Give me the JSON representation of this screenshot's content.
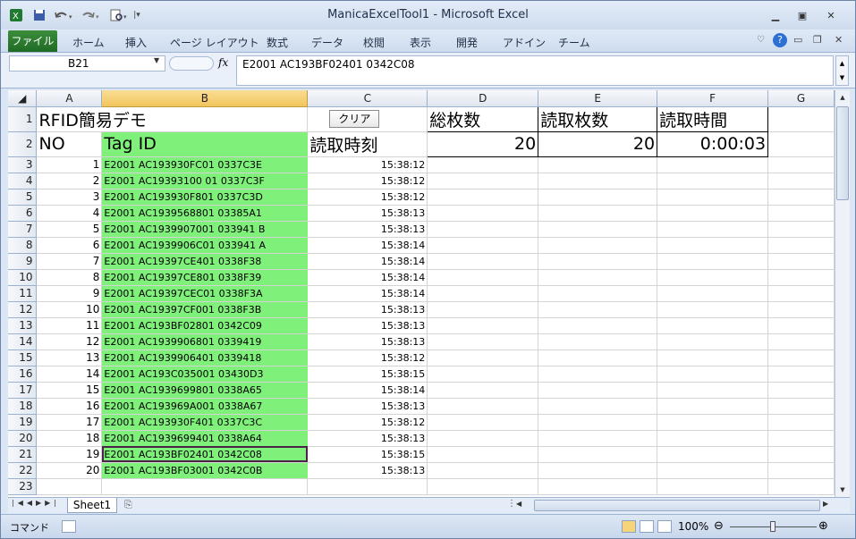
{
  "title": {
    "text": "ManicaExcelTool1 - Microsoft Excel"
  },
  "ribbon": {
    "file": "ファイル",
    "tabs": [
      "ホーム",
      "挿入",
      "ページ レイアウト",
      "数式",
      "データ",
      "校閲",
      "表示",
      "開発",
      "アドイン",
      "チーム"
    ]
  },
  "formula": {
    "namebox": "B21",
    "fx": "fx",
    "content": "E2001 AC193BF02401 0342C08"
  },
  "columns": [
    "A",
    "B",
    "C",
    "D",
    "E",
    "F",
    "G"
  ],
  "header_rows": {
    "r1": {
      "title": "RFID簡易デモ",
      "clear": "クリア",
      "total_label": "総枚数",
      "read_label": "読取枚数",
      "time_label": "読取時間"
    },
    "r2": {
      "no": "NO",
      "tag": "Tag ID",
      "readtime": "読取時刻",
      "total": "20",
      "read": "20",
      "elapsed": "0:00:03"
    }
  },
  "rows": [
    {
      "row": "3",
      "no": "1",
      "tag": "E2001 AC193930FC01 0337C3E",
      "time": "15:38:12"
    },
    {
      "row": "4",
      "no": "2",
      "tag": "E2001 AC19393100 01 0337C3F",
      "time": "15:38:12"
    },
    {
      "row": "5",
      "no": "3",
      "tag": "E2001 AC193930F801 0337C3D",
      "time": "15:38:12"
    },
    {
      "row": "6",
      "no": "4",
      "tag": "E2001 AC1939568801 03385A1",
      "time": "15:38:13"
    },
    {
      "row": "7",
      "no": "5",
      "tag": "E2001 AC1939907001 033941 B",
      "time": "15:38:13"
    },
    {
      "row": "8",
      "no": "6",
      "tag": "E2001 AC1939906C01 033941 A",
      "time": "15:38:14"
    },
    {
      "row": "9",
      "no": "7",
      "tag": "E2001 AC19397CE401 0338F38",
      "time": "15:38:14"
    },
    {
      "row": "10",
      "no": "8",
      "tag": "E2001 AC19397CE801 0338F39",
      "time": "15:38:14"
    },
    {
      "row": "11",
      "no": "9",
      "tag": "E2001 AC19397CEC01 0338F3A",
      "time": "15:38:14"
    },
    {
      "row": "12",
      "no": "10",
      "tag": "E2001 AC19397CF001 0338F3B",
      "time": "15:38:13"
    },
    {
      "row": "13",
      "no": "11",
      "tag": "E2001 AC193BF02801 0342C09",
      "time": "15:38:13"
    },
    {
      "row": "14",
      "no": "12",
      "tag": "E2001 AC1939906801 0339419",
      "time": "15:38:13"
    },
    {
      "row": "15",
      "no": "13",
      "tag": "E2001 AC1939906401 0339418",
      "time": "15:38:12"
    },
    {
      "row": "16",
      "no": "14",
      "tag": "E2001 AC193C035001 03430D3",
      "time": "15:38:15"
    },
    {
      "row": "17",
      "no": "15",
      "tag": "E2001 AC1939699801 0338A65",
      "time": "15:38:14"
    },
    {
      "row": "18",
      "no": "16",
      "tag": "E2001 AC193969A001 0338A67",
      "time": "15:38:13"
    },
    {
      "row": "19",
      "no": "17",
      "tag": "E2001 AC193930F401 0337C3C",
      "time": "15:38:12"
    },
    {
      "row": "20",
      "no": "18",
      "tag": "E2001 AC1939699401 0338A64",
      "time": "15:38:13"
    },
    {
      "row": "21",
      "no": "19",
      "tag": "E2001 AC193BF02401 0342C08",
      "time": "15:38:15"
    },
    {
      "row": "22",
      "no": "20",
      "tag": "E2001 AC193BF03001 0342C0B",
      "time": "15:38:13"
    }
  ],
  "empty_row": "23",
  "row_headers": {
    "r1": "1",
    "r2": "2"
  },
  "sheet": {
    "tab": "Sheet1"
  },
  "status": {
    "mode": "コマンド",
    "zoom": "100%"
  },
  "colors": {
    "tag_fill": "#7ff07a",
    "file_tab": "#2b7a2f",
    "selection": "#4a2448"
  },
  "icons": [
    "excel-app-icon",
    "save-icon",
    "undo-icon",
    "redo-icon",
    "print-preview-icon",
    "minimize-icon",
    "restore-icon",
    "close-icon",
    "help-icon"
  ]
}
